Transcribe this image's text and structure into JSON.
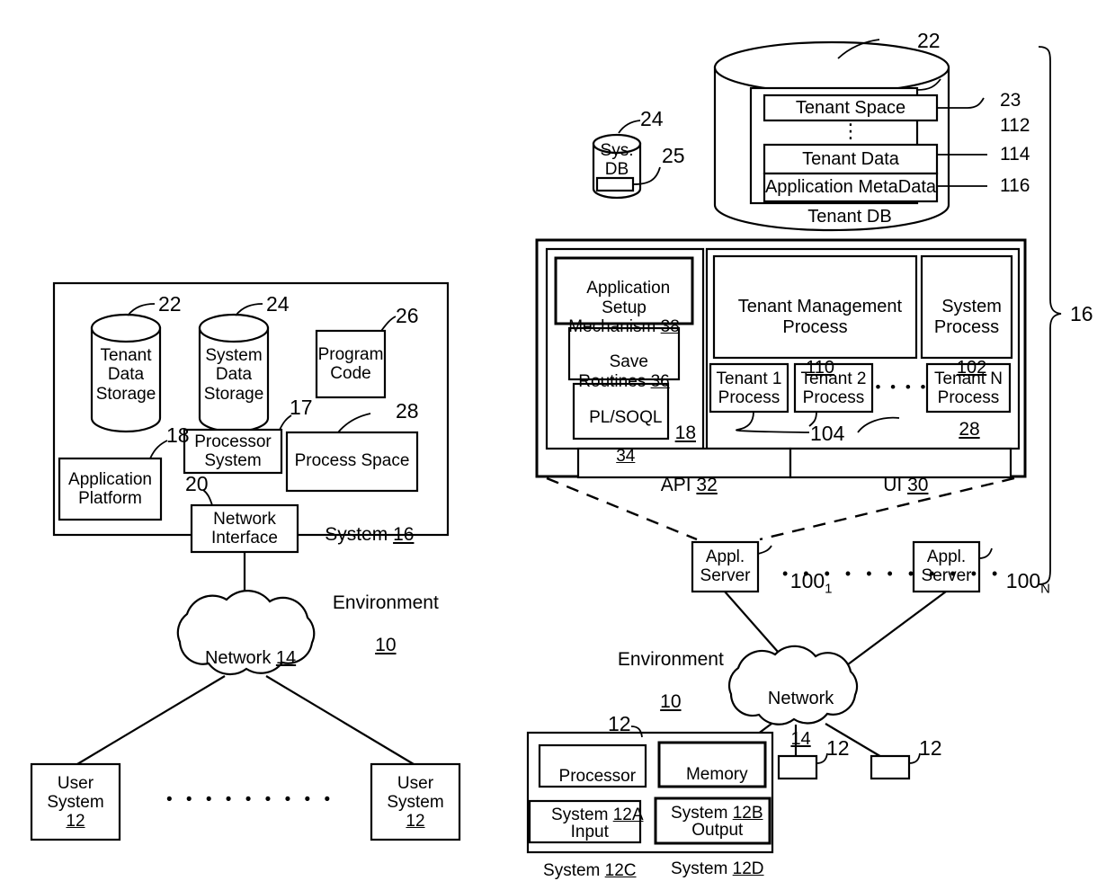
{
  "figure": {
    "title": "Multi-tenant database system environment diagram",
    "stroke": "#000000",
    "background": "#ffffff"
  },
  "left_diagram": {
    "system_box_label": "System",
    "system_box_number": "16",
    "environment_label": "Environment",
    "environment_number": "10",
    "tenant_data_storage": "Tenant\nData\nStorage",
    "tenant_data_storage_number": "22",
    "system_data_storage": "System\nData\nStorage",
    "system_data_storage_number": "24",
    "program_code": "Program\nCode",
    "program_code_number": "26",
    "processor_system": "Processor\nSystem",
    "processor_system_number": "17",
    "process_space": "Process Space",
    "process_space_number": "28",
    "application_platform": "Application\nPlatform",
    "application_platform_number": "18",
    "network_interface": "Network\nInterface",
    "network_interface_number": "20",
    "network_label": "Network",
    "network_number": "14",
    "user_system_left": "User\nSystem",
    "user_system_left_number": "12",
    "user_system_right": "User\nSystem",
    "user_system_right_number": "12",
    "ellipsis": "• • • • • • • • •"
  },
  "right_diagram": {
    "bracket_number": "16",
    "sys_db": "Sys.\nDB",
    "sys_db_number": "24",
    "sys_db_inner_number": "25",
    "tenant_db_label": "Tenant DB",
    "tenant_db_number": "22",
    "tenant_db_inner_number": "23",
    "tenant_space": "Tenant Space",
    "tenant_space_number": "112",
    "vertical_ellipsis": "⋮",
    "tenant_data": "Tenant Data",
    "tenant_data_number": "114",
    "application_metadata": "Application MetaData",
    "application_metadata_number": "116",
    "application_setup_mechanism": "Application\nSetup\nMechanism",
    "application_setup_mechanism_number": "38",
    "save_routines": "Save\nRoutines",
    "save_routines_number": "36",
    "pl_soql": "PL/SOQL",
    "pl_soql_number": "34",
    "app_platform_number": "18",
    "tenant_management_process": "Tenant Management\nProcess",
    "tenant_management_process_number": "110",
    "system_process": "System\nProcess",
    "system_process_number": "102",
    "tenant_1_process": "Tenant 1\nProcess",
    "tenant_2_process": "Tenant 2\nProcess",
    "tenant_n_process": "Tenant N\nProcess",
    "tenant_process_ellipsis": "• • • •",
    "tenant_process_number": "104",
    "process_space_number": "28",
    "api_label": "API",
    "api_number": "32",
    "ui_label": "UI",
    "ui_number": "30",
    "appl_server_1": "Appl.\nServer",
    "appl_server_1_number": "100",
    "appl_server_1_sub": "1",
    "appl_server_n": "Appl.\nServer",
    "appl_server_n_number": "100",
    "appl_server_n_sub": "N",
    "server_ellipsis": "• • • • • • • • • • •",
    "environment_label": "Environment",
    "environment_number": "10",
    "network_label": "Network",
    "network_number": "14",
    "user_system_number": "12",
    "user_system_small_1_number": "12",
    "user_system_small_2_number": "12",
    "processor_system": "Processor",
    "processor_system_sub": "System",
    "processor_system_number": "12A",
    "memory_system": "Memory",
    "memory_system_sub": "System",
    "memory_system_number": "12B",
    "input_system": "Input",
    "input_system_sub": "System",
    "input_system_number": "12C",
    "output_system": "Output",
    "output_system_sub": "System",
    "output_system_number": "12D"
  }
}
